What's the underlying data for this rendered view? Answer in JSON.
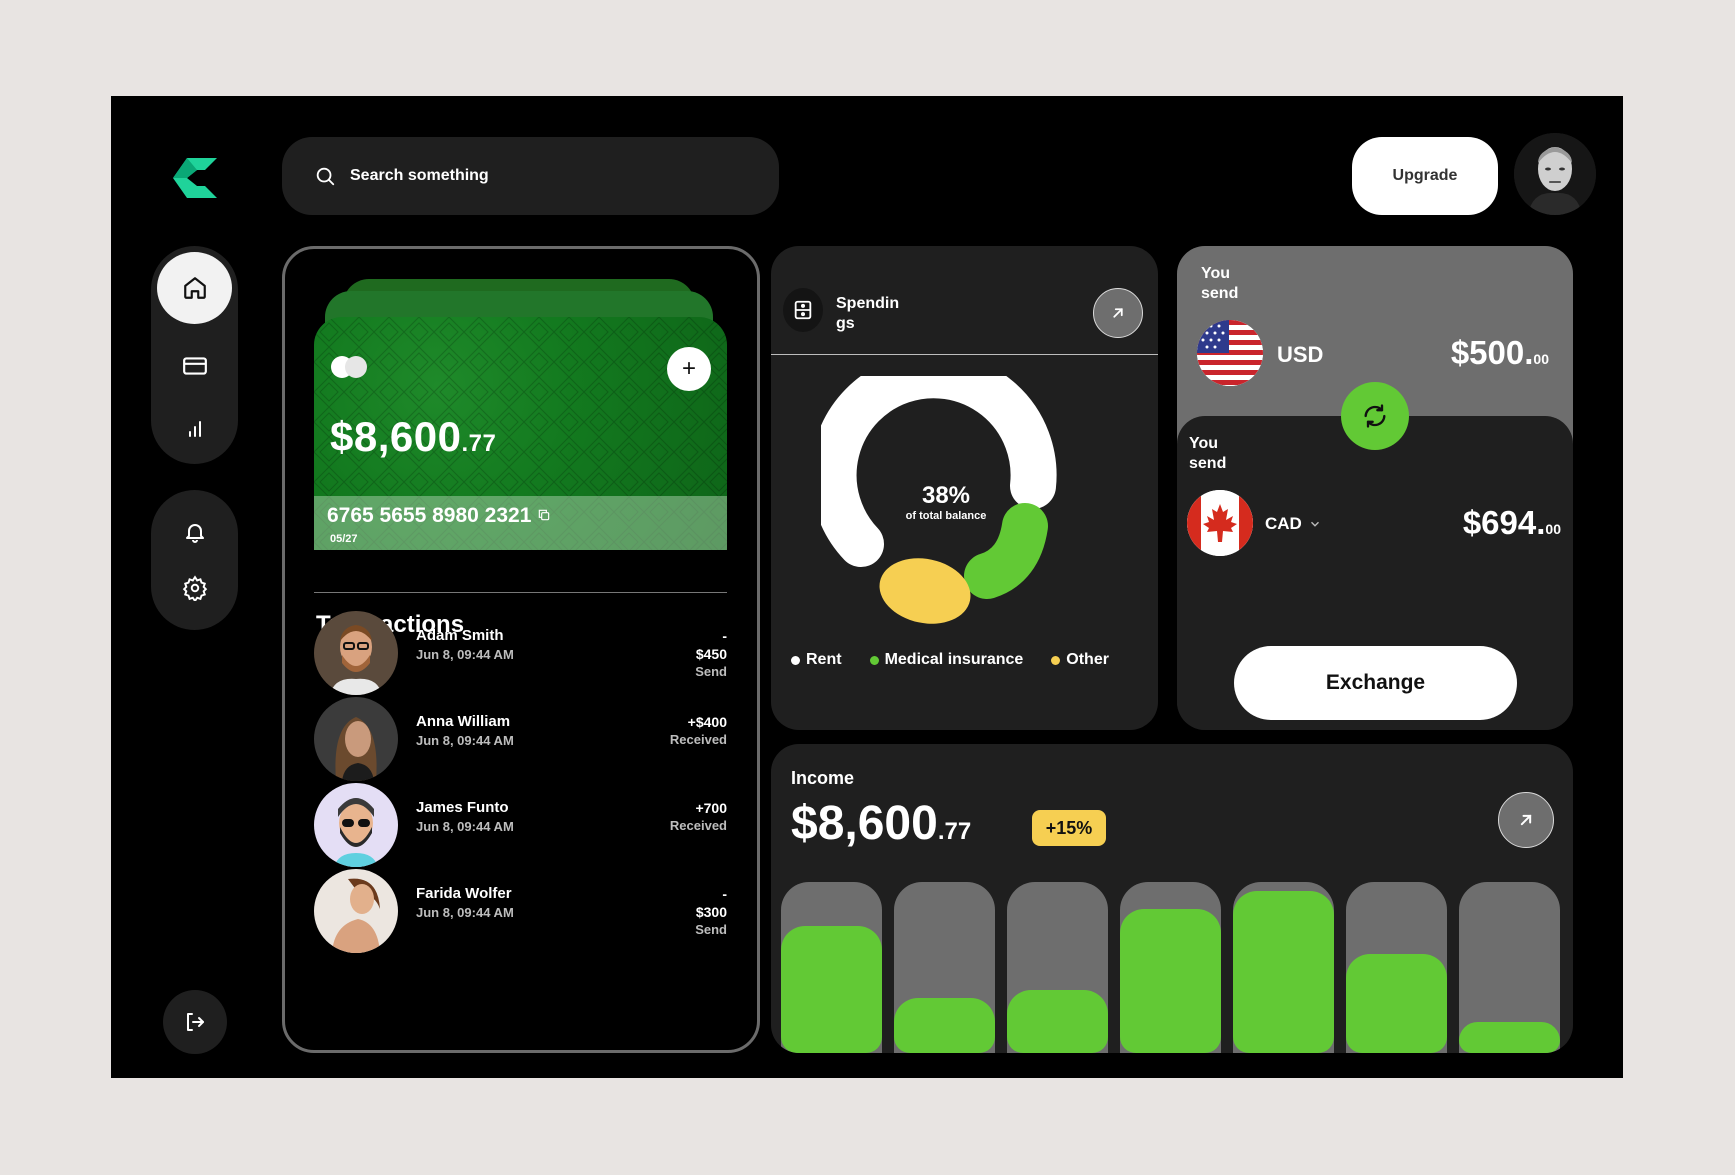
{
  "colors": {
    "accent": "#62c935",
    "yellow": "#f6cf52",
    "panel": "#1f1f1f",
    "gray": "#6e6e6e"
  },
  "search": {
    "placeholder": "Search something"
  },
  "header": {
    "upgrade_label": "Upgrade"
  },
  "sidebar": {
    "icons": [
      "home-icon",
      "card-icon",
      "chart-icon",
      "bell-icon",
      "gear-icon",
      "logout-icon"
    ]
  },
  "card": {
    "balance_main": "$8,600",
    "balance_cents": ".77",
    "number": "6765 5655 8980 2321",
    "expiry": "05/27"
  },
  "transactions": {
    "title": "Transactions",
    "items": [
      {
        "name": "Adam Smith",
        "date": "Jun 8, 09:44 AM",
        "sign": "-",
        "amount": "$450",
        "kind": "Send"
      },
      {
        "name": "Anna William",
        "date": "Jun 8, 09:44 AM",
        "sign": "",
        "amount": "+$400",
        "kind": "Received"
      },
      {
        "name": "James Funto",
        "date": "Jun 8, 09:44 AM",
        "sign": "",
        "amount": "+700",
        "kind": "Received"
      },
      {
        "name": "Farida Wolfer",
        "date": "Jun 8, 09:44 AM",
        "sign": "-",
        "amount": "$300",
        "kind": "Send"
      }
    ]
  },
  "spendings": {
    "title": "Spendings",
    "percent": "38%",
    "percent_label": "of total balance",
    "legend": [
      {
        "label": "Rent",
        "color": "#ffffff"
      },
      {
        "label": "Medical insurance",
        "color": "#62c935"
      },
      {
        "label": "Other",
        "color": "#f6cf52"
      }
    ]
  },
  "exchange": {
    "from": {
      "label": "You send",
      "currency": "USD",
      "amount": "$500.",
      "cents": "00"
    },
    "to": {
      "label": "You send",
      "currency": "CAD",
      "amount": "$694.",
      "cents": "00"
    },
    "button_label": "Exchange"
  },
  "income": {
    "title": "Income",
    "amount_main": "$8,600",
    "amount_cents": ".77",
    "change": "+15%",
    "bar_levels": [
      0.74,
      0.32,
      0.37,
      0.84,
      0.95,
      0.58,
      0.18
    ]
  }
}
